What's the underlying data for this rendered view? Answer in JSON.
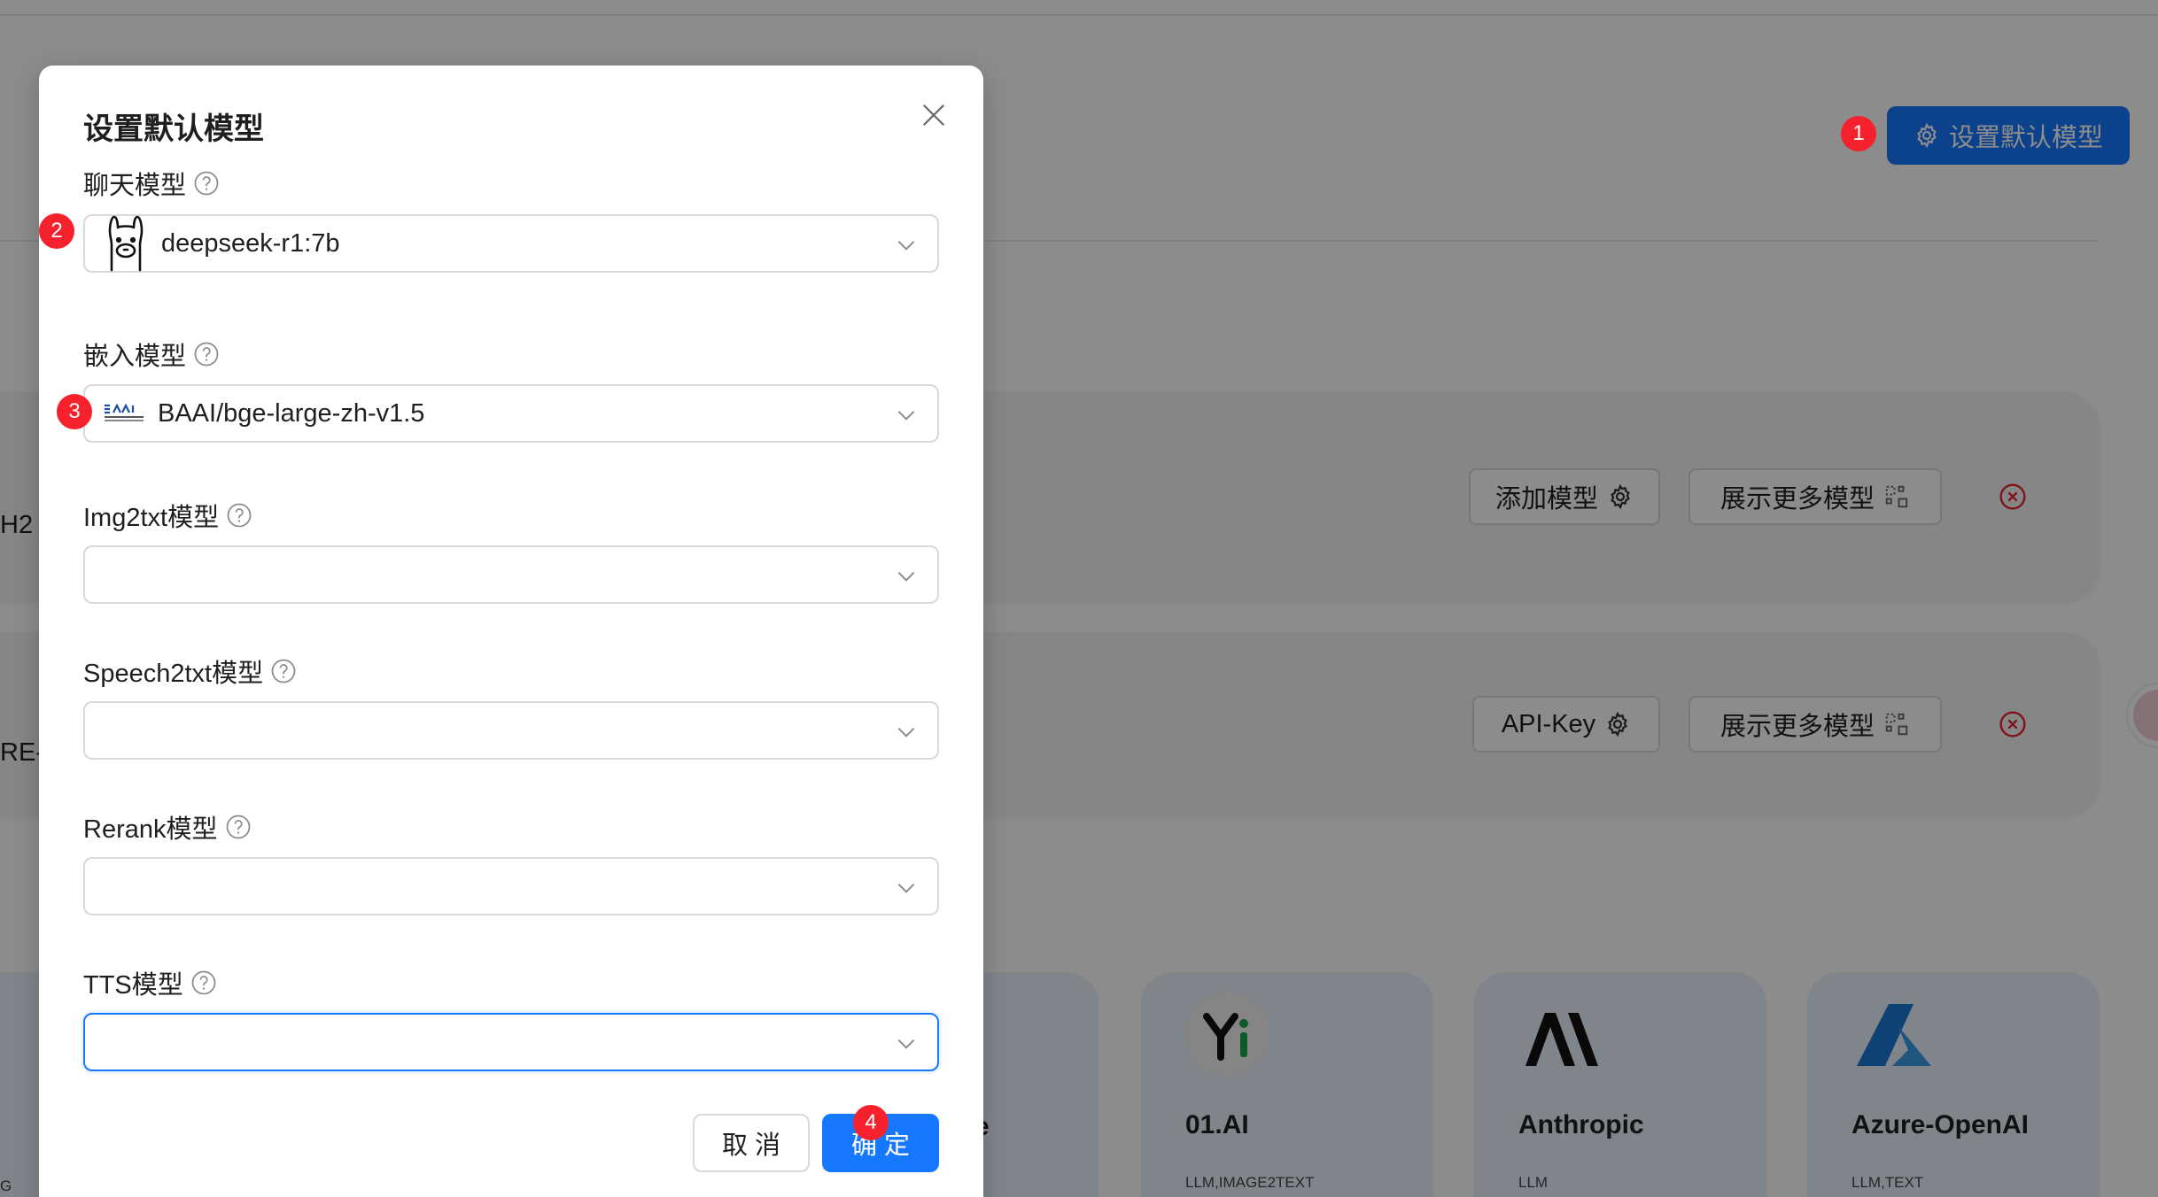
{
  "page": {
    "default_model_button": "设置默认模型",
    "card1": {
      "name_fragment": "H2",
      "add_button": "添加模型",
      "more_button": "展示更多模型"
    },
    "card2": {
      "name_fragment": "RE-I",
      "apikey_button": "API-Key",
      "more_button": "展示更多模型"
    },
    "providers": [
      {
        "name": "01.AI",
        "tags": "LLM,IMAGE2TEXT",
        "logo": "01ai-logo"
      },
      {
        "name": "Anthropic",
        "tags": "LLM",
        "logo": "anthropic-logo"
      },
      {
        "name": "Azure-OpenAI",
        "tags": "LLM,TEXT",
        "logo": "azure-logo"
      }
    ],
    "fragment_name_tail": "e",
    "fragment_tags_tail": "G"
  },
  "modal": {
    "title": "设置默认模型",
    "fields": {
      "chat": {
        "label": "聊天模型",
        "value": "deepseek-r1:7b",
        "logo": "ollama-llama-icon"
      },
      "embedding": {
        "label": "嵌入模型",
        "value": "BAAI/bge-large-zh-v1.5",
        "logo": "baai-logo"
      },
      "img2txt": {
        "label": "Img2txt模型",
        "value": ""
      },
      "speech2txt": {
        "label": "Speech2txt模型",
        "value": ""
      },
      "rerank": {
        "label": "Rerank模型",
        "value": ""
      },
      "tts": {
        "label": "TTS模型",
        "value": ""
      }
    },
    "cancel_label": "取 消",
    "ok_label": "确 定"
  },
  "badges": [
    "1",
    "2",
    "3",
    "4"
  ],
  "colors": {
    "primary": "#1677ff",
    "badge_red": "#f5222d",
    "card_bg": "#f4f4f5",
    "provider_bg": "#eaf2fd",
    "remove_red": "#e8242f"
  }
}
